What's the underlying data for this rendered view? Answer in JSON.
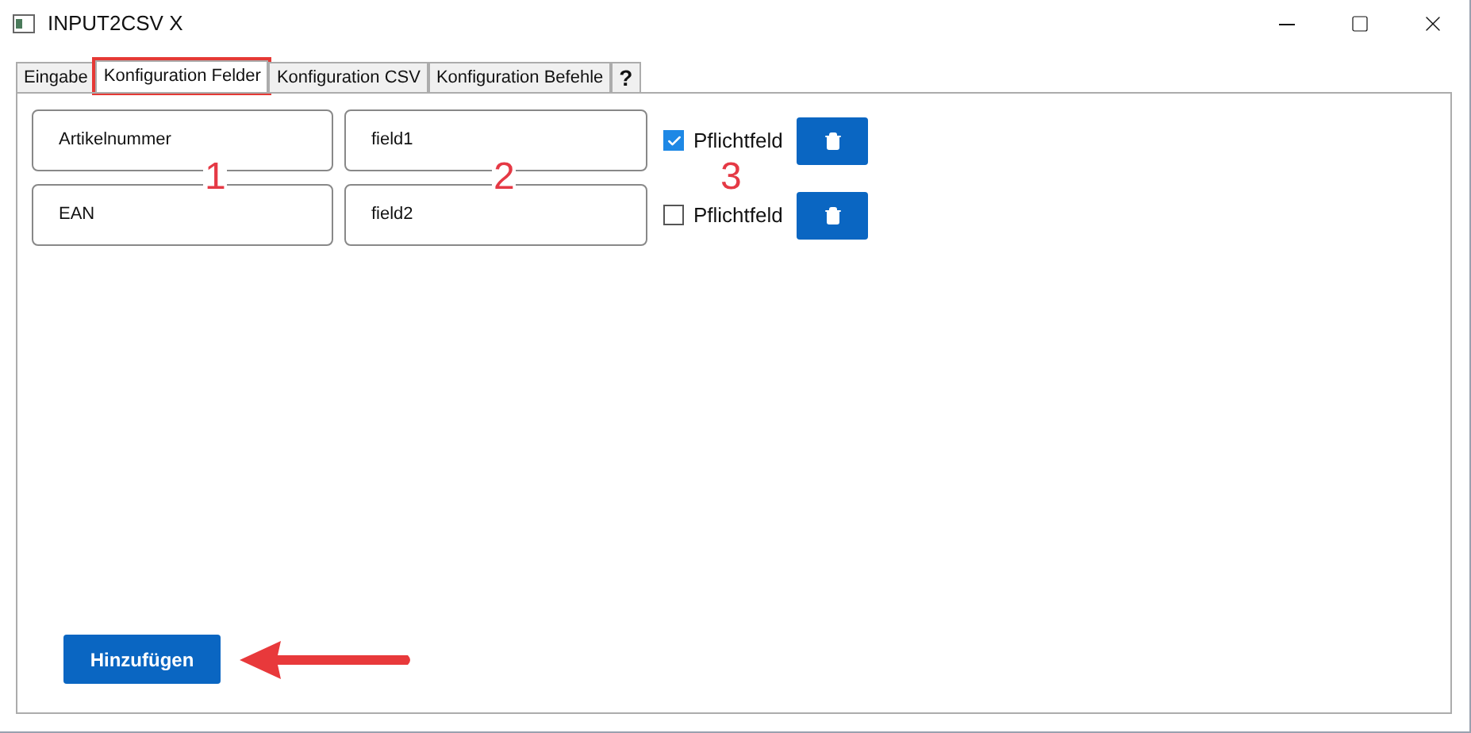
{
  "window": {
    "title": "INPUT2CSV X"
  },
  "tabs": [
    {
      "label": "Eingabe",
      "selected": false,
      "highlighted": false
    },
    {
      "label": "Konfiguration Felder",
      "selected": true,
      "highlighted": true
    },
    {
      "label": "Konfiguration CSV",
      "selected": false,
      "highlighted": false
    },
    {
      "label": "Konfiguration Befehle",
      "selected": false,
      "highlighted": false
    },
    {
      "label": "?",
      "selected": false,
      "highlighted": false
    }
  ],
  "fields": [
    {
      "name": "Artikelnummer",
      "field": "field1",
      "required_label": "Pflichtfeld",
      "checked": true
    },
    {
      "name": "EAN",
      "field": "field2",
      "required_label": "Pflichtfeld",
      "checked": false
    }
  ],
  "annotations": [
    "1",
    "2",
    "3"
  ],
  "add_button": "Hinzufügen"
}
